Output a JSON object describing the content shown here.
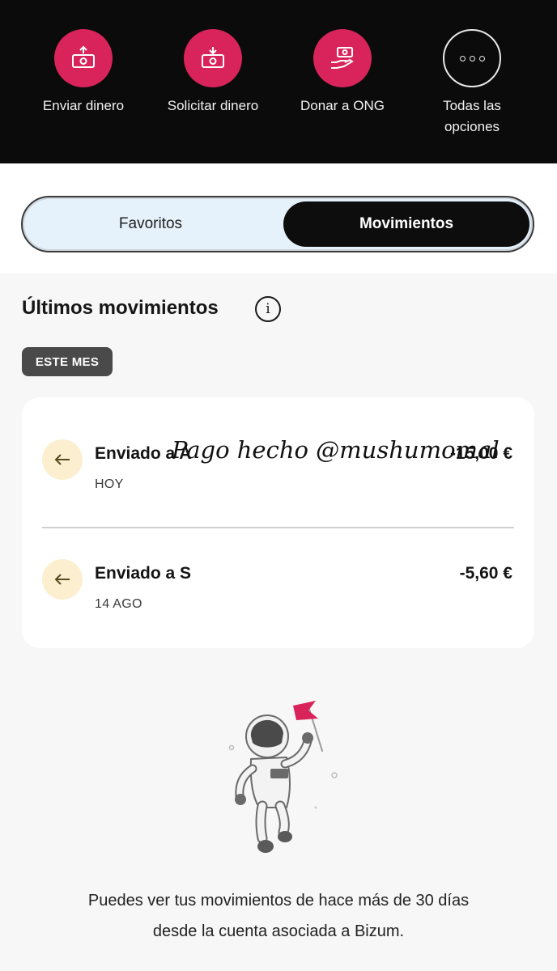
{
  "actions": [
    {
      "label": "Enviar dinero",
      "icon": "send-money-icon"
    },
    {
      "label": "Solicitar dinero",
      "icon": "request-money-icon"
    },
    {
      "label": "Donar a ONG",
      "icon": "donate-icon"
    },
    {
      "label_line1": "Todas las",
      "label_line2": "opciones",
      "icon": "more-dots-icon"
    }
  ],
  "tabs": {
    "favorites": "Favoritos",
    "movements": "Movimientos",
    "active": "Movimientos"
  },
  "section": {
    "title": "Últimos movimientos",
    "info_glyph": "i",
    "period_badge": "ESTE MES"
  },
  "transactions": [
    {
      "name": "Enviado a A",
      "date": "HOY",
      "amount": "-15,00 €"
    },
    {
      "name": "Enviado a S",
      "date": "14 AGO",
      "amount": "-5,60 €"
    }
  ],
  "overlay_note": "Pago hecho @mushumomal",
  "footer": {
    "line1": "Puedes ver tus movimientos de hace más de 30 días",
    "line2": "desde la cuenta asociada a Bizum."
  },
  "colors": {
    "accent": "#d9245b",
    "dark": "#0b0b0b",
    "tab_bg": "#e5f1fb",
    "arrow_bg": "#fbefcf"
  }
}
